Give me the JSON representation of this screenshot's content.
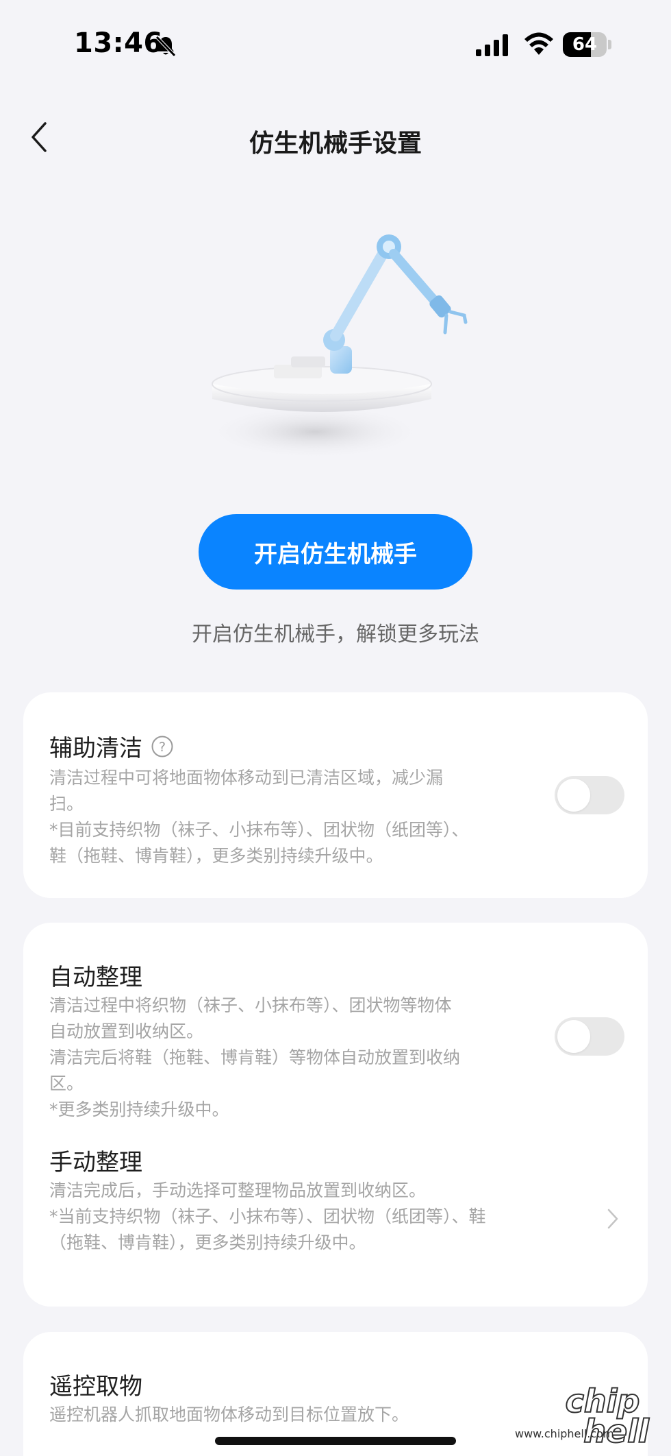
{
  "status_bar": {
    "time": "13:46",
    "battery_level": "64",
    "battery_percent": 0.64
  },
  "header": {
    "title": "仿生机械手设置"
  },
  "hero": {
    "button_label": "开启仿生机械手",
    "hint": "开启仿生机械手，解锁更多玩法"
  },
  "settings": {
    "assist_clean": {
      "title": "辅助清洁",
      "desc": [
        "清洁过程中可将地面物体移动到已清洁区域，减少漏",
        "扫。",
        "*目前支持织物（袜子、小抹布等）、团状物（纸团等）、",
        "鞋（拖鞋、博肯鞋），更多类别持续升级中。"
      ],
      "enabled": false
    },
    "auto_organize": {
      "title": "自动整理",
      "desc": [
        "清洁过程中将织物（袜子、小抹布等）、团状物等物体",
        "自动放置到收纳区。",
        "清洁完后将鞋（拖鞋、博肯鞋）等物体自动放置到收纳",
        "区。",
        "*更多类别持续升级中。"
      ],
      "enabled": false
    },
    "manual_organize": {
      "title": "手动整理",
      "desc": [
        "清洁完成后，手动选择可整理物品放置到收纳区。",
        "*当前支持织物（袜子、小抹布等）、团状物（纸团等）、鞋",
        "（拖鞋、博肯鞋），更多类别持续升级中。"
      ]
    },
    "remote_pick": {
      "title": "遥控取物",
      "desc": [
        "遥控机器人抓取地面物体移动到目标位置放下。"
      ]
    }
  },
  "watermark": {
    "logo": "chip hell",
    "url": "www.chiphell.com"
  },
  "colors": {
    "accent": "#0A84FF",
    "background": "#F4F4F8",
    "card": "#FFFFFF",
    "muted_text": "#A5A5A5",
    "toggle_off": "#E8E8E8"
  }
}
